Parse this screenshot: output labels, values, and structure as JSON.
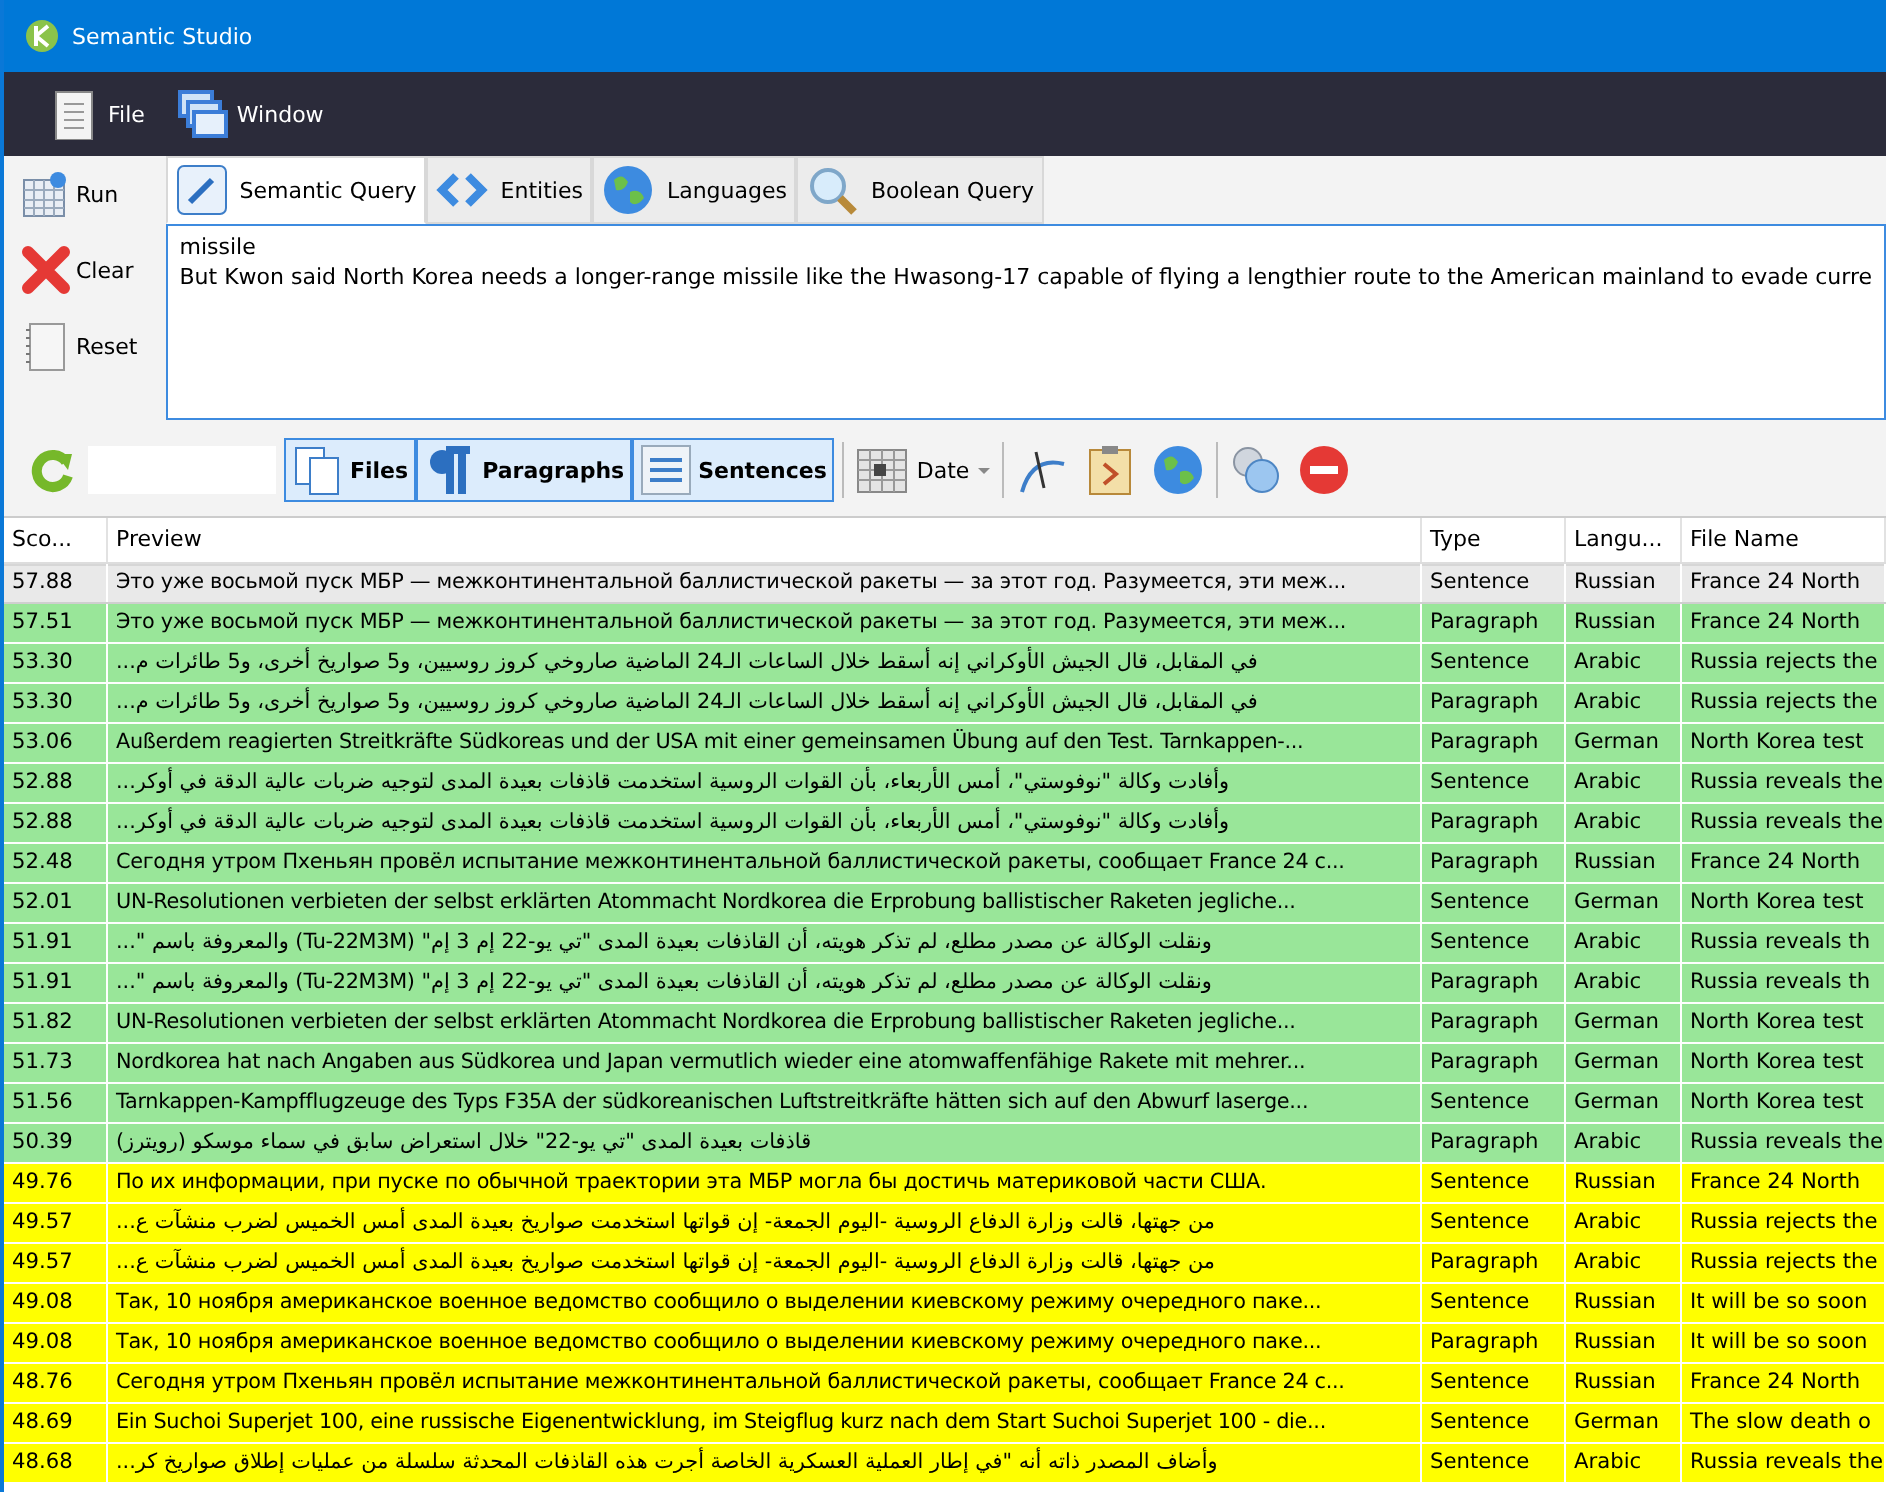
{
  "window": {
    "title": "Semantic Studio"
  },
  "menu": [
    {
      "label": "File",
      "kind": "file"
    },
    {
      "label": "Window",
      "kind": "window"
    }
  ],
  "actions": [
    {
      "label": "Run",
      "kind": "run"
    },
    {
      "label": "Clear",
      "kind": "clear"
    },
    {
      "label": "Reset",
      "kind": "reset"
    }
  ],
  "tabs": [
    {
      "label": "Semantic Query",
      "kind": "pencil",
      "selected": true
    },
    {
      "label": "Entities",
      "kind": "code",
      "selected": false
    },
    {
      "label": "Languages",
      "kind": "globe",
      "selected": false
    },
    {
      "label": "Boolean Query",
      "kind": "search",
      "selected": false
    }
  ],
  "query": {
    "lines": [
      "missile",
      "But Kwon said North Korea needs a longer-range missile like the Hwasong-17 capable of flying a lengthier route to the American mainland to evade curre"
    ]
  },
  "toolbar": {
    "granularity": [
      {
        "label": "Files",
        "kind": "files",
        "selected": true
      },
      {
        "label": "Paragraphs",
        "kind": "paragraphs",
        "selected": true
      },
      {
        "label": "Sentences",
        "kind": "sentences",
        "selected": true
      }
    ],
    "sort": {
      "label": "Date"
    },
    "tools": [
      {
        "kind": "curve"
      },
      {
        "kind": "clipboard"
      },
      {
        "kind": "globe"
      },
      {
        "kind": "bubbles"
      },
      {
        "kind": "stop"
      }
    ]
  },
  "table": {
    "columns": [
      "Sco...",
      "Preview",
      "Type",
      "Langu...",
      "File Name"
    ],
    "rows": [
      {
        "cells": [
          "57.88",
          "Это уже восьмой пуск МБР — межконтинентальной баллистической ракеты — за этот год. Разумеется, эти меж...",
          "Sentence",
          "Russian",
          "France 24 North"
        ],
        "color": "#e9e9e9",
        "selected": true
      },
      {
        "cells": [
          "57.51",
          "Это уже восьмой пуск МБР — межконтинентальной баллистической ракеты — за этот год. Разумеется, эти меж...",
          "Paragraph",
          "Russian",
          "France 24 North"
        ],
        "color": "#99e699",
        "selected": false
      },
      {
        "cells": [
          "53.30",
          "...في المقابل، قال الجيش الأوكراني إنه أسقط خلال الساعات الـ24 الماضية صاروخي كروز روسيين، و5 صواريخ أخرى، و5 طائرات م",
          "Sentence",
          "Arabic",
          "Russia rejects the"
        ],
        "color": "#99e699",
        "selected": false
      },
      {
        "cells": [
          "53.30",
          "...في المقابل، قال الجيش الأوكراني إنه أسقط خلال الساعات الـ24 الماضية صاروخي كروز روسيين، و5 صواريخ أخرى، و5 طائرات م",
          "Paragraph",
          "Arabic",
          "Russia rejects the"
        ],
        "color": "#99e699",
        "selected": false
      },
      {
        "cells": [
          "53.06",
          "Außerdem reagierten Streitkräfte Südkoreas und der USA mit einer gemeinsamen Übung auf den Test. Tarnkappen-...",
          "Paragraph",
          "German",
          "North Korea test"
        ],
        "color": "#99e699",
        "selected": false
      },
      {
        "cells": [
          "52.88",
          "...وأفادت وكالة \"نوفوستي\"، أمس الأربعاء، بأن القوات الروسية استخدمت قاذفات بعيدة المدى لتوجيه ضربات عالية الدقة في أوكر",
          "Sentence",
          "Arabic",
          "Russia reveals the"
        ],
        "color": "#99e699",
        "selected": false
      },
      {
        "cells": [
          "52.88",
          "...وأفادت وكالة \"نوفوستي\"، أمس الأربعاء، بأن القوات الروسية استخدمت قاذفات بعيدة المدى لتوجيه ضربات عالية الدقة في أوكر",
          "Paragraph",
          "Arabic",
          "Russia reveals the"
        ],
        "color": "#99e699",
        "selected": false
      },
      {
        "cells": [
          "52.48",
          "Сегодня утром Пхеньян провёл испытание межконтинентальной баллистической ракеты, сообщает France 24 с...",
          "Paragraph",
          "Russian",
          "France 24 North"
        ],
        "color": "#99e699",
        "selected": false
      },
      {
        "cells": [
          "52.01",
          "UN-Resolutionen verbieten der selbst erklärten Atommacht Nordkorea die Erprobung ballistischer Raketen jegliche...",
          "Sentence",
          "German",
          "North Korea test"
        ],
        "color": "#99e699",
        "selected": false
      },
      {
        "cells": [
          "51.91",
          "...\" والمعروفة باسم (Tu-22M3M) \"ونقلت الوكالة عن مصدر مطلع، لم تذكر هويته، أن القاذفات بعيدة المدى \"تي يو-22 إم 3 إم",
          "Sentence",
          "Arabic",
          "Russia reveals th"
        ],
        "color": "#99e699",
        "selected": false
      },
      {
        "cells": [
          "51.91",
          "...\" والمعروفة باسم (Tu-22M3M) \"ونقلت الوكالة عن مصدر مطلع، لم تذكر هويته، أن القاذفات بعيدة المدى \"تي يو-22 إم 3 إم",
          "Paragraph",
          "Arabic",
          "Russia reveals th"
        ],
        "color": "#99e699",
        "selected": false
      },
      {
        "cells": [
          "51.82",
          "UN-Resolutionen verbieten der selbst erklärten Atommacht Nordkorea die Erprobung ballistischer Raketen jegliche...",
          "Paragraph",
          "German",
          "North Korea test"
        ],
        "color": "#99e699",
        "selected": false
      },
      {
        "cells": [
          "51.73",
          "Nordkorea hat nach Angaben aus Südkorea und Japan vermutlich wieder eine atomwaffenfähige Rakete mit mehrer...",
          "Paragraph",
          "German",
          "North Korea test"
        ],
        "color": "#99e699",
        "selected": false
      },
      {
        "cells": [
          "51.56",
          "Tarnkappen-Kampfflugzeuge des Typs F35A der südkoreanischen Luftstreitkräfte hätten sich auf den Abwurf laserge...",
          "Sentence",
          "German",
          "North Korea test"
        ],
        "color": "#99e699",
        "selected": false
      },
      {
        "cells": [
          "50.39",
          "قاذفات بعيدة المدى \"تي يو-22\" خلال استعراض سابق في سماء موسكو (رويترز)",
          "Paragraph",
          "Arabic",
          "Russia reveals the"
        ],
        "color": "#99e699",
        "selected": false
      },
      {
        "cells": [
          "49.76",
          "По их информации, при пуске по обычной траектории эта МБР могла бы достичь материковой части США.",
          "Sentence",
          "Russian",
          "France 24 North"
        ],
        "color": "#ffff00",
        "selected": false
      },
      {
        "cells": [
          "49.57",
          "...من جهتها، قالت وزارة الدفاع الروسية -اليوم الجمعة- إن قواتها استخدمت صواريخ بعيدة المدى أمس الخميس لضرب منشآت ع",
          "Sentence",
          "Arabic",
          "Russia rejects the"
        ],
        "color": "#ffff00",
        "selected": false
      },
      {
        "cells": [
          "49.57",
          "...من جهتها، قالت وزارة الدفاع الروسية -اليوم الجمعة- إن قواتها استخدمت صواريخ بعيدة المدى أمس الخميس لضرب منشآت ع",
          "Paragraph",
          "Arabic",
          "Russia rejects the"
        ],
        "color": "#ffff00",
        "selected": false
      },
      {
        "cells": [
          "49.08",
          "Так, 10 ноября американское военное ведомство сообщило о выделении киевскому режиму очередного паке...",
          "Sentence",
          "Russian",
          "It will be so soon"
        ],
        "color": "#ffff00",
        "selected": false
      },
      {
        "cells": [
          "49.08",
          "Так, 10 ноября американское военное ведомство сообщило о выделении киевскому режиму очередного паке...",
          "Paragraph",
          "Russian",
          "It will be so soon"
        ],
        "color": "#ffff00",
        "selected": false
      },
      {
        "cells": [
          "48.76",
          "Сегодня утром Пхеньян провёл испытание межконтинентальной баллистической ракеты, сообщает France 24 с...",
          "Sentence",
          "Russian",
          "France 24 North"
        ],
        "color": "#ffff00",
        "selected": false
      },
      {
        "cells": [
          "48.69",
          "Ein Suchoi Superjet 100, eine russische Eigenentwicklung, im Steigflug kurz nach dem Start Suchoi Superjet 100 - die...",
          "Sentence",
          "German",
          "The slow death o"
        ],
        "color": "#ffff00",
        "selected": false
      },
      {
        "cells": [
          "48.68",
          "...وأضاف المصدر ذاته أنه \"في إطار العملية العسكرية الخاصة أجرت هذه القاذفات المحدثة سلسلة من عمليات إطلاق صواريخ كر",
          "Sentence",
          "Arabic",
          "Russia reveals the"
        ],
        "color": "#ffff00",
        "selected": false
      }
    ]
  }
}
